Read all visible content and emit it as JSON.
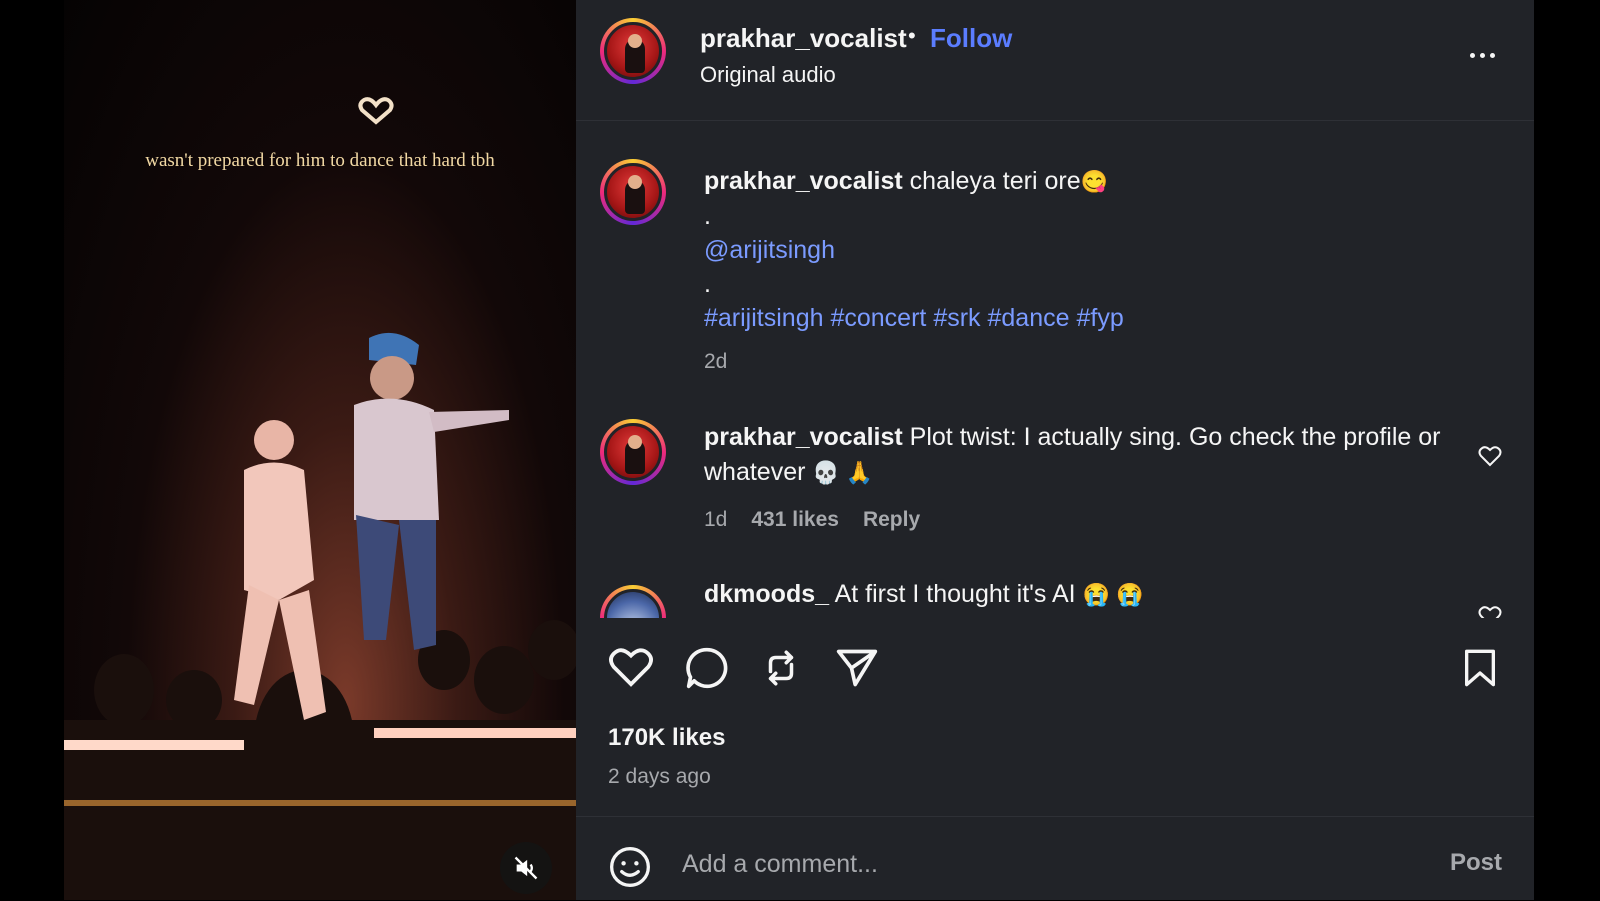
{
  "video": {
    "overlay_text": "wasn't prepared for him to dance that hard tbh",
    "overlay_icon": "heart-hands-icon",
    "mute_icon": "muted-speaker-icon"
  },
  "header": {
    "username": "prakhar_vocalist",
    "separator": "•",
    "follow_label": "Follow",
    "audio_label": "Original audio"
  },
  "caption": {
    "username": "prakhar_vocalist",
    "text": "chaleya teri ore",
    "emoji": "😋",
    "dot1": ".",
    "mention": "@arijitsingh",
    "dot2": ".",
    "hashtags": [
      "#arijitsingh",
      "#concert",
      "#srk",
      "#dance",
      "#fyp"
    ],
    "time": "2d"
  },
  "comments": [
    {
      "username": "prakhar_vocalist",
      "text": "Plot twist: I actually sing. Go check the profile or whatever",
      "emoji": "💀 🙏",
      "time": "1d",
      "likes": "431 likes",
      "reply": "Reply"
    },
    {
      "username": "dkmoods_",
      "text": "At first I thought it's AI",
      "emoji": "😭 😭"
    }
  ],
  "actions": {
    "like_icon": "heart-icon",
    "comment_icon": "comment-bubble-icon",
    "repost_icon": "repost-icon",
    "share_icon": "send-icon",
    "save_icon": "bookmark-icon"
  },
  "stats": {
    "likes": "170K likes",
    "posted": "2 days ago"
  },
  "composer": {
    "placeholder": "Add a comment...",
    "post_label": "Post"
  },
  "colors": {
    "panel_bg": "#212328",
    "link": "#7b9bff",
    "follow": "#5b7dff",
    "muted_text": "#a7a9ad"
  }
}
